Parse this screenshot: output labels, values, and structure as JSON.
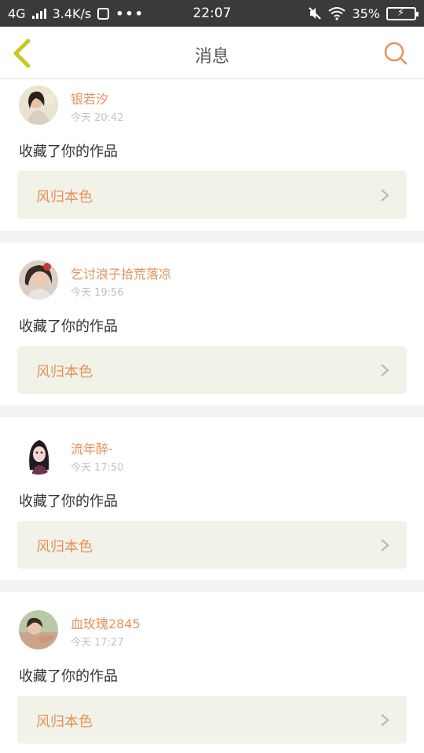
{
  "status_bar": {
    "network": "4G",
    "speed": "3.4K/s",
    "dots": "•••",
    "time": "22:07",
    "battery": "35%"
  },
  "header": {
    "title": "消息"
  },
  "colors": {
    "accent": "#e6915a",
    "back_icon": "#c9c81f",
    "card_link_bg": "#f1f2e8"
  },
  "messages": [
    {
      "username": "银若汐",
      "time": "今天 20:42",
      "action": "收藏了你的作品",
      "work_title": "风归本色"
    },
    {
      "username": "乞讨浪子拾荒落凉",
      "time": "今天 19:56",
      "action": "收藏了你的作品",
      "work_title": "风归本色"
    },
    {
      "username": "流年醉-",
      "time": "今天 17:50",
      "action": "收藏了你的作品",
      "work_title": "风归本色"
    },
    {
      "username": "血玫瑰2845",
      "time": "今天 17:27",
      "action": "收藏了你的作品",
      "work_title": "风归本色"
    }
  ]
}
